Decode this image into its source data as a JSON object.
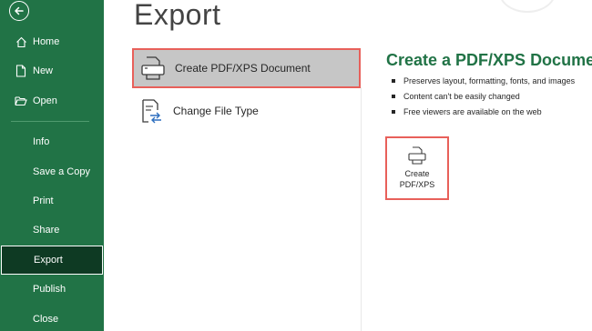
{
  "sidebar": {
    "back_icon": "back-arrow-icon",
    "items": [
      {
        "label": "Home",
        "icon": "home-icon"
      },
      {
        "label": "New",
        "icon": "new-document-icon"
      },
      {
        "label": "Open",
        "icon": "folder-open-icon"
      },
      {
        "label": "Info"
      },
      {
        "label": "Save a Copy"
      },
      {
        "label": "Print"
      },
      {
        "label": "Share"
      },
      {
        "label": "Export",
        "active": true
      },
      {
        "label": "Publish"
      },
      {
        "label": "Close"
      }
    ]
  },
  "main": {
    "title": "Export",
    "options": [
      {
        "label": "Create PDF/XPS Document",
        "icon": "pdf-document-icon",
        "selected": true
      },
      {
        "label": "Change File Type",
        "icon": "change-file-type-icon"
      }
    ],
    "detail": {
      "title": "Create a PDF/XPS Document",
      "bullets": [
        "Preserves layout, formatting, fonts, and images",
        "Content can't be easily changed",
        "Free viewers are available on the web"
      ],
      "button_label": "Create\nPDF/XPS"
    }
  },
  "colors": {
    "sidebar_bg": "#217346",
    "active_bg": "#0e3a23",
    "accent": "#217346",
    "highlight_border": "#e8605a",
    "selected_bg": "#c6c6c6"
  }
}
